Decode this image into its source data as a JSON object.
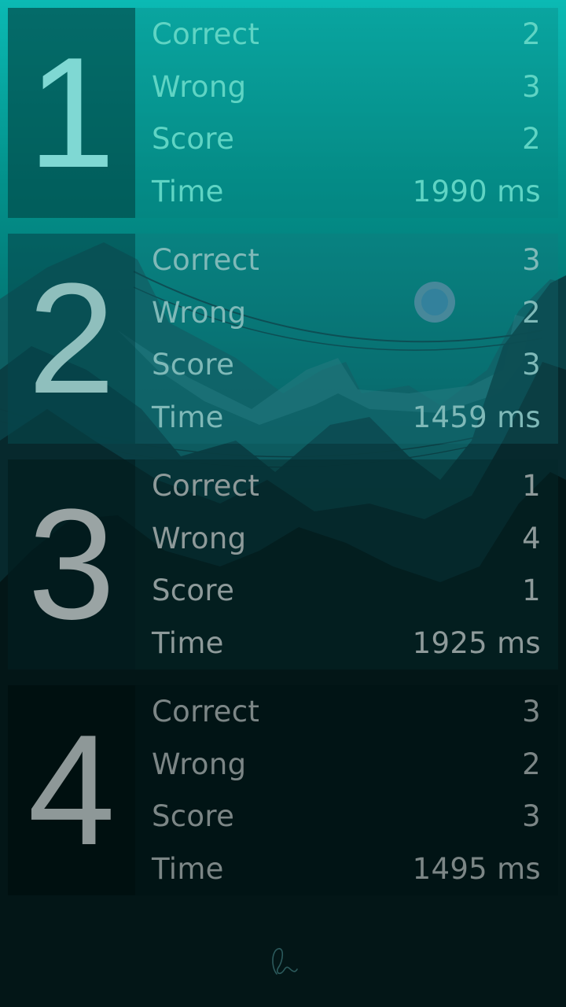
{
  "rounds": [
    {
      "number": "1",
      "correct_label": "Correct",
      "correct": "2",
      "wrong_label": "Wrong",
      "wrong": "3",
      "score_label": "Score",
      "score": "2",
      "time_label": "Time",
      "time": "1990 ms"
    },
    {
      "number": "2",
      "correct_label": "Correct",
      "correct": "3",
      "wrong_label": "Wrong",
      "wrong": "2",
      "score_label": "Score",
      "score": "3",
      "time_label": "Time",
      "time": "1459 ms"
    },
    {
      "number": "3",
      "correct_label": "Correct",
      "correct": "1",
      "wrong_label": "Wrong",
      "wrong": "4",
      "score_label": "Score",
      "score": "1",
      "time_label": "Time",
      "time": "1925 ms"
    },
    {
      "number": "4",
      "correct_label": "Correct",
      "correct": "3",
      "wrong_label": "Wrong",
      "wrong": "2",
      "score_label": "Score",
      "score": "3",
      "time_label": "Time",
      "time": "1495 ms"
    }
  ],
  "colors": {
    "sky_top": "#0ab5b0",
    "sky_mid": "#007d78",
    "ground": "#031414",
    "card1_text": "#5fd4c4",
    "card2_text": "#7fb9b8",
    "card3_text": "#8e9a9a",
    "card4_text": "#7c8686"
  }
}
